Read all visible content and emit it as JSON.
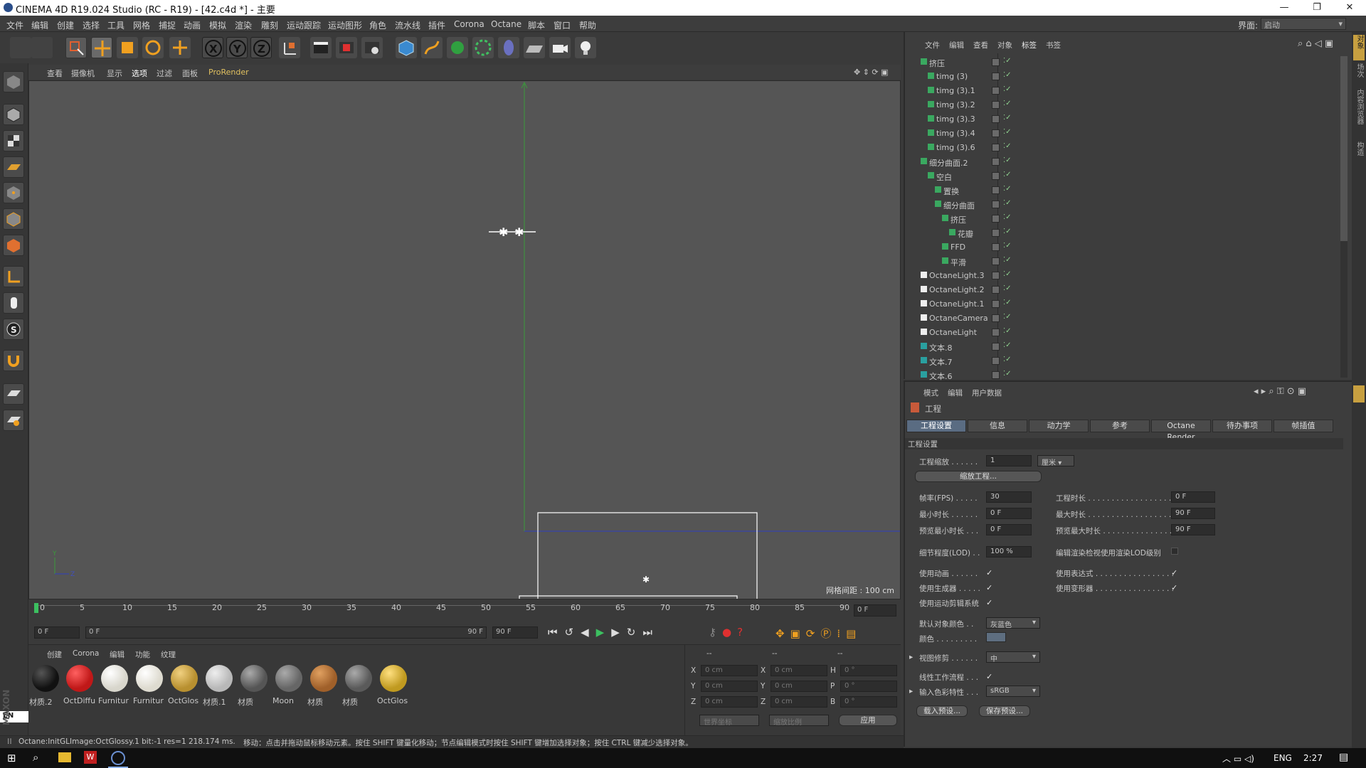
{
  "window": {
    "title": "CINEMA 4D R19.024 Studio (RC - R19) - [42.c4d *] - 主要"
  },
  "menu": [
    "文件",
    "编辑",
    "创建",
    "选择",
    "工具",
    "网格",
    "捕捉",
    "动画",
    "模拟",
    "渲染",
    "雕刻",
    "运动跟踪",
    "运动图形",
    "角色",
    "流水线",
    "插件",
    "Corona",
    "Octane",
    "脚本",
    "窗口",
    "帮助"
  ],
  "layout": {
    "label": "界面:",
    "value": "启动"
  },
  "viewport_menu": [
    "查看",
    "摄像机",
    "显示",
    "选项",
    "过滤",
    "面板",
    "ProRender"
  ],
  "viewport": {
    "grid_label": "网格间距 : 100 cm"
  },
  "timeline": {
    "ticks": [
      "0",
      "5",
      "10",
      "15",
      "20",
      "25",
      "30",
      "35",
      "40",
      "45",
      "50",
      "55",
      "60",
      "65",
      "70",
      "75",
      "80",
      "85",
      "90"
    ],
    "current_frame": "0 F",
    "start_frame": "0 F",
    "range_start": "0 F",
    "range_end": "90 F",
    "end_frame": "90 F"
  },
  "material_menu": [
    "创建",
    "Corona",
    "编辑",
    "功能",
    "纹理"
  ],
  "materials": [
    {
      "label": "材质.2",
      "color": "#111111"
    },
    {
      "label": "OctDiffu",
      "color": "#c01818"
    },
    {
      "label": "Furnitur",
      "color": "#d8d6cc"
    },
    {
      "label": "Furnitur",
      "color": "#dedbd0"
    },
    {
      "label": "OctGlos",
      "color": "#b89030"
    },
    {
      "label": "材质.1",
      "color": "#b8b8b8"
    },
    {
      "label": "材质",
      "color": "#6a6a6a"
    },
    {
      "label": "Moon",
      "color": "#777777"
    },
    {
      "label": "材质",
      "color": "#a0602a"
    },
    {
      "label": "材质",
      "color": "#6e6e6e"
    },
    {
      "label": "OctGlos",
      "color": "#c09a20"
    }
  ],
  "coords": {
    "headers": [
      "--",
      "--",
      "--"
    ],
    "rows": [
      {
        "a": "X",
        "av": "0 cm",
        "b": "X",
        "bv": "0 cm",
        "c": "H",
        "cv": "0 °"
      },
      {
        "a": "Y",
        "av": "0 cm",
        "b": "Y",
        "bv": "0 cm",
        "c": "P",
        "cv": "0 °"
      },
      {
        "a": "Z",
        "av": "0 cm",
        "b": "Z",
        "bv": "0 cm",
        "c": "B",
        "cv": "0 °"
      }
    ],
    "world": "世界坐标",
    "scale": "缩放比例",
    "apply": "应用"
  },
  "lang_badge": "EN",
  "status": {
    "left": "Octane:InitGLImage:OctGlossy.1  bit:-1 res=1  218.174 ms.",
    "right": "移动：点击并拖动鼠标移动元素。按住 SHIFT 键量化移动；节点编辑模式时按住 SHIFT 键增加选择对象；按住 CTRL 键减少选择对象。"
  },
  "object_menu": [
    "文件",
    "编辑",
    "查看",
    "对象",
    "标签",
    "书签"
  ],
  "objects": [
    {
      "name": "挤压",
      "indent": 0
    },
    {
      "name": "timg (3)",
      "indent": 1
    },
    {
      "name": "timg (3).1",
      "indent": 1
    },
    {
      "name": "timg (3).2",
      "indent": 1
    },
    {
      "name": "timg (3).3",
      "indent": 1
    },
    {
      "name": "timg (3).4",
      "indent": 1
    },
    {
      "name": "timg (3).6",
      "indent": 1
    },
    {
      "name": "细分曲面.2",
      "indent": 0
    },
    {
      "name": "空白",
      "indent": 1
    },
    {
      "name": "置换",
      "indent": 2
    },
    {
      "name": "细分曲面",
      "indent": 2
    },
    {
      "name": "挤压",
      "indent": 3
    },
    {
      "name": "花瓣",
      "indent": 4
    },
    {
      "name": "FFD",
      "indent": 3
    },
    {
      "name": "平滑",
      "indent": 3
    },
    {
      "name": "OctaneLight.3",
      "indent": 0
    },
    {
      "name": "OctaneLight.2",
      "indent": 0
    },
    {
      "name": "OctaneLight.1",
      "indent": 0
    },
    {
      "name": "OctaneCamera",
      "indent": 0
    },
    {
      "name": "OctaneLight",
      "indent": 0
    },
    {
      "name": "文本.8",
      "indent": 0
    },
    {
      "name": "文本.7",
      "indent": 0
    },
    {
      "name": "文本.6",
      "indent": 0
    }
  ],
  "attr_menu": [
    "模式",
    "编辑",
    "用户数据"
  ],
  "attr": {
    "header": "工程",
    "tabs": [
      "工程设置",
      "信息",
      "动力学",
      "参考",
      "Octane Render",
      "待办事项",
      "帧插值"
    ],
    "section": "工程设置",
    "scale_label": "工程缩放 . . . . . .",
    "scale_value": "1",
    "scale_unit": "厘米",
    "scale_btn": "缩放工程...",
    "fps_label": "帧率(FPS) . . . . .",
    "fps": "30",
    "length_label": "工程时长 . . . . . . . . . . . . . . . . . .",
    "length": "0 F",
    "min_label": "最小时长 . . . . . .",
    "min": "0 F",
    "max_label": "最大时长 . . . . . . . . . . . . . . . . . .",
    "max": "90 F",
    "pmin_label": "预览最小时长 . . .",
    "pmin": "0 F",
    "pmax_label": "预览最大时长 . . . . . . . . . . . . . . .",
    "pmax": "90 F",
    "lod_label": "细节程度(LOD) . .",
    "lod": "100 %",
    "lod_render_label": "编辑渲染检视使用渲染LOD级别",
    "anim_label": "使用动画 . . . . . .",
    "expr_label": "使用表达式 . . . . . . . . . . . . . . . . .",
    "gen_label": "使用生成器 . . . . .",
    "deform_label": "使用变形器 . . . . . . . . . . . . . . . . .",
    "mograph_label": "使用运动剪辑系统",
    "defcolor_label": "默认对象颜色 . .",
    "defcolor": "灰蓝色",
    "color_label": "颜色 . . . . . . . . .",
    "clip_label": "视图修剪 . . . . . .",
    "clip": "中",
    "linear_label": "线性工作流程 . . .",
    "inprof_label": "输入色彩特性 . . .",
    "inprof": "sRGB",
    "load_btn": "载入预设...",
    "save_btn": "保存预设..."
  },
  "taskbar": {
    "lang": "ENG",
    "time": "2:27"
  },
  "side_tabs": [
    "对象",
    "场次",
    "内容浏览器",
    "构造"
  ]
}
